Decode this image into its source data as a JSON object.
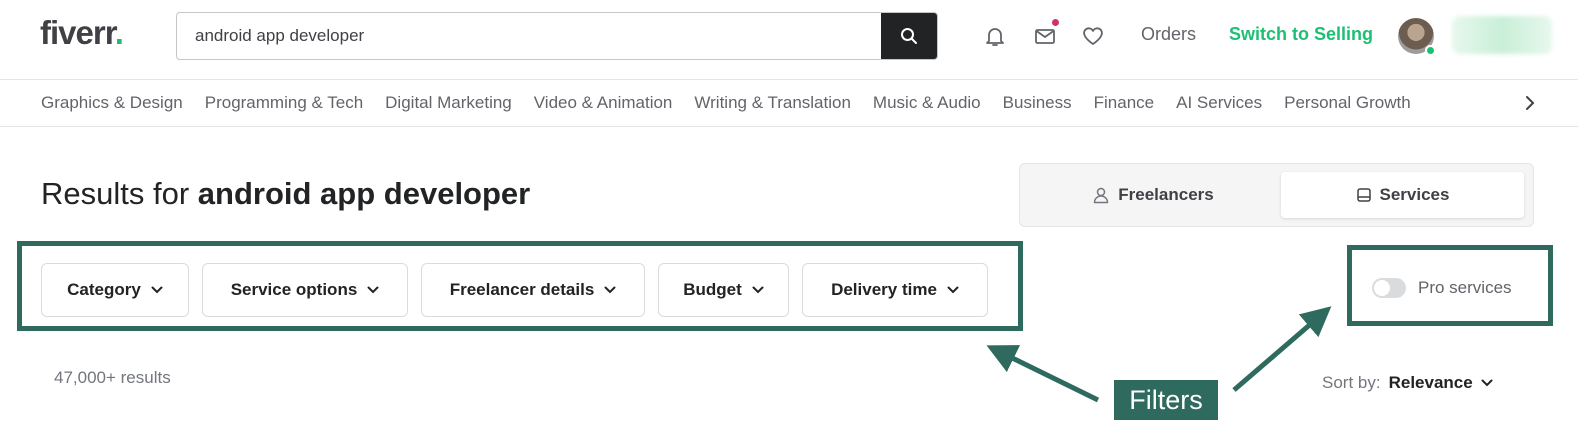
{
  "header": {
    "logo_text": "fiverr",
    "logo_dot": ".",
    "search_value": "android app developer",
    "orders_label": "Orders",
    "switch_label": "Switch to Selling",
    "icons": [
      "bell-icon",
      "mail-icon",
      "heart-icon",
      "search-icon"
    ],
    "accent_color": "#1dbf73"
  },
  "categories": [
    "Graphics & Design",
    "Programming & Tech",
    "Digital Marketing",
    "Video & Animation",
    "Writing & Translation",
    "Music & Audio",
    "Business",
    "Finance",
    "AI Services",
    "Personal Growth"
  ],
  "results": {
    "prefix": "Results for ",
    "query": "android app developer",
    "count": "47,000+ results"
  },
  "mode_toggle": {
    "freelancers": "Freelancers",
    "services": "Services",
    "selected": "Services"
  },
  "filters": [
    {
      "label": "Category"
    },
    {
      "label": "Service options"
    },
    {
      "label": "Freelancer details"
    },
    {
      "label": "Budget"
    },
    {
      "label": "Delivery time"
    }
  ],
  "pro_services": {
    "label": "Pro services",
    "enabled": false
  },
  "sort": {
    "label": "Sort by:",
    "value": "Relevance"
  },
  "annotation": {
    "label": "Filters",
    "color": "#2f6a5f"
  }
}
